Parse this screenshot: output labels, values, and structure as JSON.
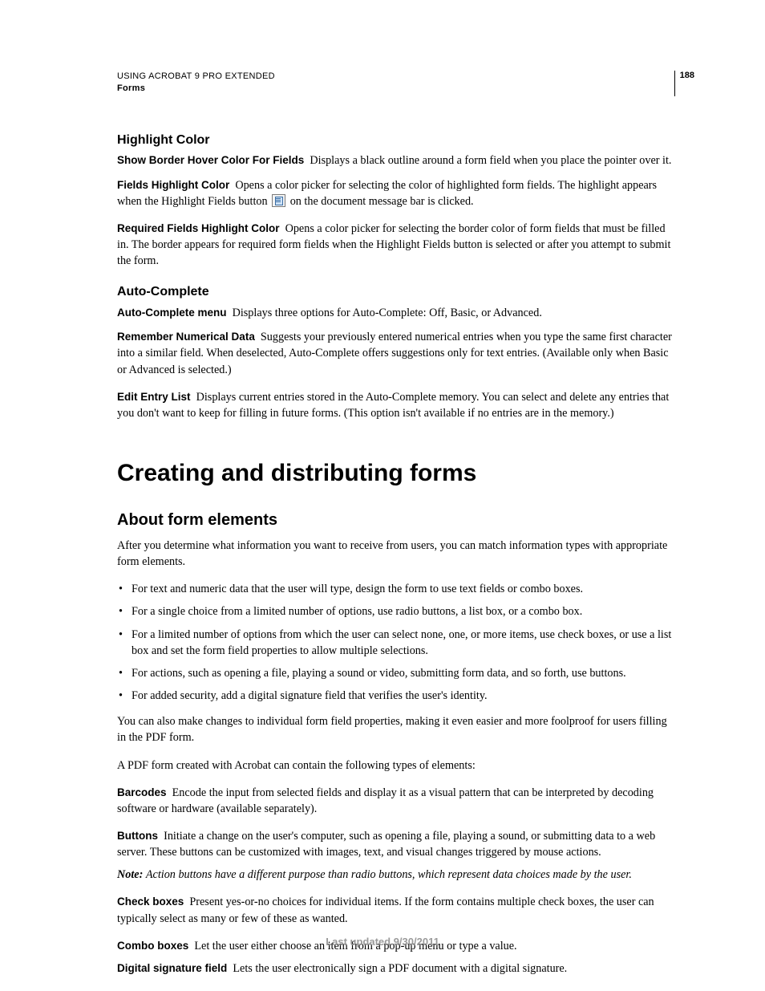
{
  "header": {
    "line1": "USING ACROBAT 9 PRO EXTENDED",
    "line2": "Forms",
    "page_number": "188"
  },
  "s1": {
    "title": "Highlight Color",
    "items": [
      {
        "term": "Show Border Hover Color For Fields",
        "desc": "Displays a black outline around a form field when you place the pointer over it."
      },
      {
        "term": "Fields Highlight Color",
        "desc_before": "Opens a color picker for selecting the color of highlighted form fields. The highlight appears when the Highlight Fields button",
        "desc_after": "on the document message bar is clicked."
      },
      {
        "term": "Required Fields Highlight Color",
        "desc": "Opens a color picker for selecting the border color of form fields that must be filled in. The border appears for required form fields when the Highlight Fields button is selected or after you attempt to submit the form."
      }
    ]
  },
  "s2": {
    "title": "Auto-Complete",
    "items": [
      {
        "term": "Auto-Complete menu",
        "desc": "Displays three options for Auto-Complete: Off, Basic, or Advanced."
      },
      {
        "term": "Remember Numerical Data",
        "desc": "Suggests your previously entered numerical entries when you type the same first character into a similar field. When deselected, Auto-Complete offers suggestions only for text entries. (Available only when Basic or Advanced is selected.)"
      },
      {
        "term": "Edit Entry List",
        "desc": "Displays current entries stored in the Auto-Complete memory. You can select and delete any entries that you don't want to keep for filling in future forms. (This option isn't available if no entries are in the memory.)"
      }
    ]
  },
  "chapter": {
    "title": "Creating and distributing forms"
  },
  "s3": {
    "title": "About form elements",
    "intro": "After you determine what information you want to receive from users, you can match information types with appropriate form elements.",
    "bullets": [
      "For text and numeric data that the user will type, design the form to use text fields or combo boxes.",
      "For a single choice from a limited number of options, use radio buttons, a list box, or a combo box.",
      "For a limited number of options from which the user can select none, one, or more items, use check boxes, or use a list box and set the form field properties to allow multiple selections.",
      "For actions, such as opening a file, playing a sound or video, submitting form data, and so forth, use buttons.",
      "For added security, add a digital signature field that verifies the user's identity."
    ],
    "para2": "You can also make changes to individual form field properties, making it even easier and more foolproof for users filling in the PDF form.",
    "para3": "A PDF form created with Acrobat can contain the following types of elements:",
    "defs": [
      {
        "term": "Barcodes",
        "desc": "Encode the input from selected fields and display it as a visual pattern that can be interpreted by decoding software or hardware (available separately)."
      },
      {
        "term": "Buttons",
        "desc": "Initiate a change on the user's computer, such as opening a file, playing a sound, or submitting data to a web server. These buttons can be customized with images, text, and visual changes triggered by mouse actions."
      }
    ],
    "note": {
      "label": "Note:",
      "body": "Action buttons have a different purpose than radio buttons, which represent data choices made by the user."
    },
    "defs2": [
      {
        "term": "Check boxes",
        "desc": "Present yes-or-no choices for individual items. If the form contains multiple check boxes, the user can typically select as many or few of these as wanted."
      },
      {
        "term": "Combo boxes",
        "desc": "Let the user either choose an item from a pop-up menu or type a value."
      },
      {
        "term": "Digital signature field",
        "desc": "Lets the user electronically sign a PDF document with a digital signature."
      }
    ]
  },
  "footer": "Last updated 9/30/2011"
}
